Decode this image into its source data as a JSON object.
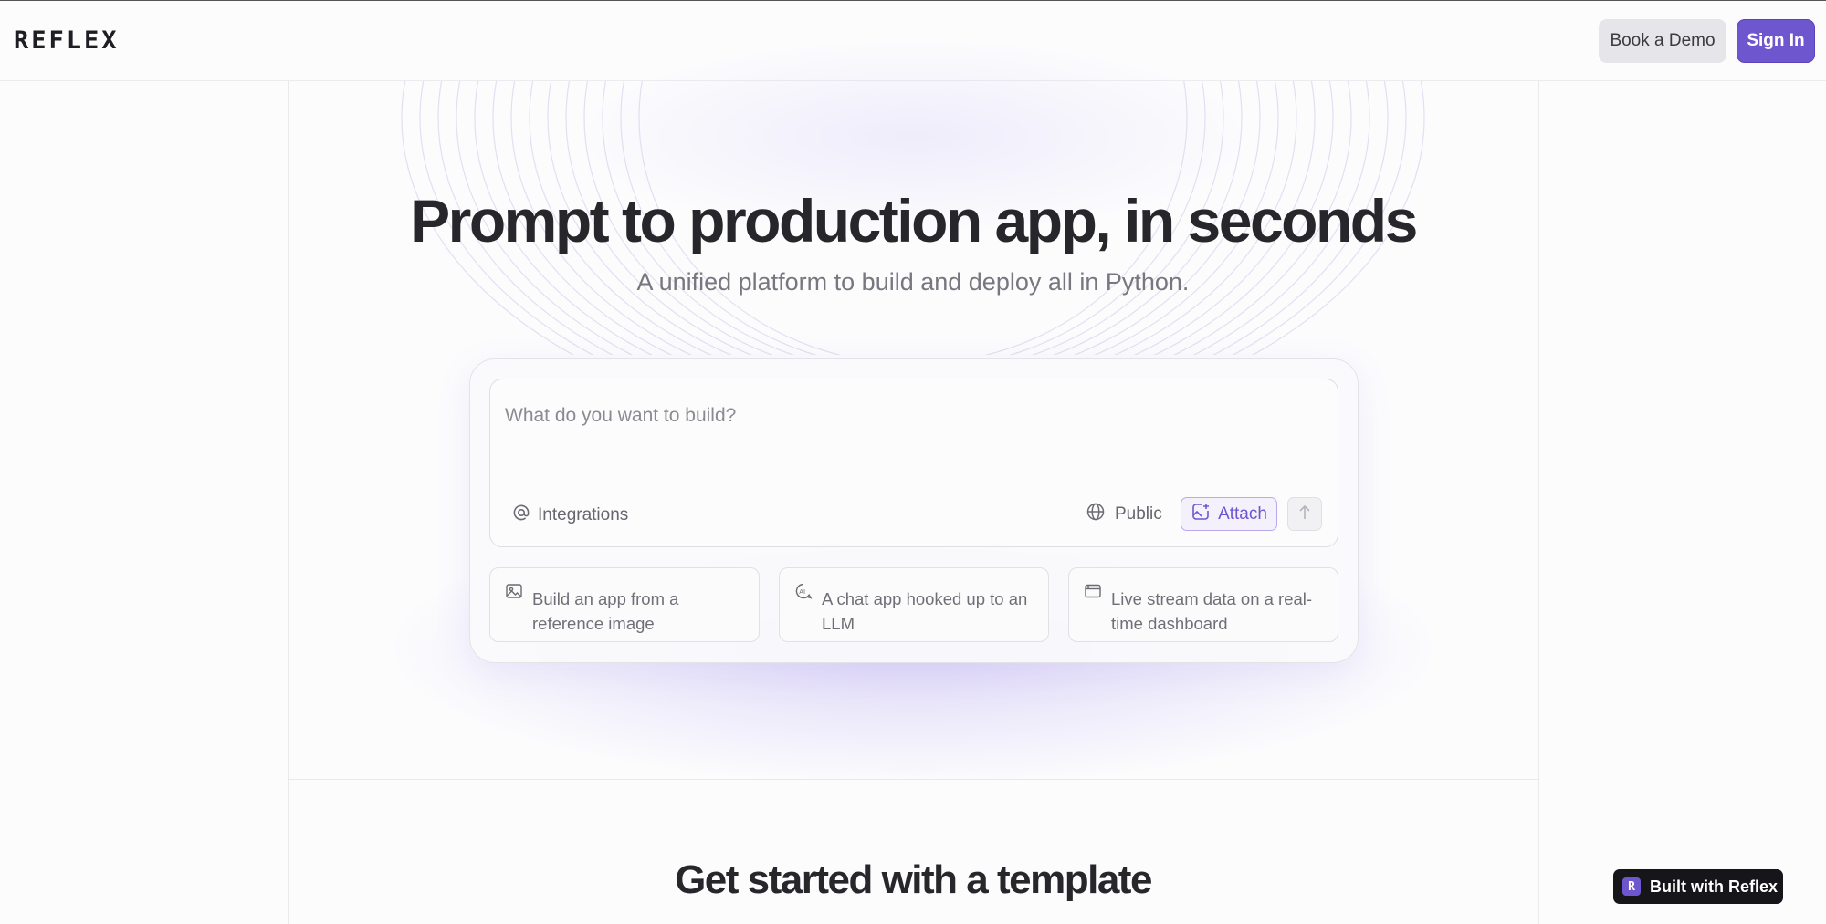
{
  "header": {
    "logo": "REFLEX",
    "book_demo_label": "Book a Demo",
    "sign_in_label": "Sign In"
  },
  "hero": {
    "title": "Prompt to production app, in seconds",
    "subtitle": "A unified platform to build and deploy all in Python."
  },
  "prompt": {
    "placeholder": "What do you want to build?",
    "integrations_label": "Integrations",
    "visibility_label": "Public",
    "attach_label": "Attach"
  },
  "suggestions": [
    {
      "label": "Build an app from a reference image",
      "icon": "image-icon"
    },
    {
      "label": "A chat app hooked up to an LLM",
      "icon": "ai-chat-icon"
    },
    {
      "label": "Live stream data on a real-time dashboard",
      "icon": "browser-window-icon"
    }
  ],
  "templates": {
    "title": "Get started with a template"
  },
  "badge": {
    "label": "Built with Reflex",
    "mark": "R"
  },
  "colors": {
    "accent": "#6e56cf",
    "background": "#fcfcfd",
    "text": "#26262b"
  }
}
